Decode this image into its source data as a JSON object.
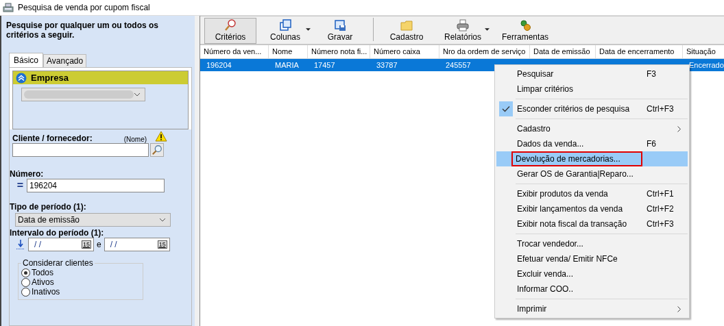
{
  "window": {
    "title": "Pesquisa de venda por cupom fiscal"
  },
  "criteria_panel": {
    "heading": "Pesquise por qualquer um ou todos os critérios a seguir.",
    "tabs": [
      {
        "label": "Básico",
        "selected": true
      },
      {
        "label": "Avançado",
        "selected": false
      }
    ],
    "empresa": {
      "label": "Empresa",
      "expanded": true
    },
    "cliente": {
      "label": "Cliente / fornecedor:",
      "hint": "(Nome)"
    },
    "numero": {
      "label": "Número:",
      "operator": "=",
      "value": "196204"
    },
    "tipo_periodo": {
      "label": "Tipo de período (1):",
      "value": "Data de emissão"
    },
    "intervalo": {
      "label": "Intervalo do período (1):",
      "from": "/ /",
      "to": "/ /",
      "joiner": "e",
      "from_calendar": "15",
      "to_calendar": "15"
    },
    "considerar_clientes": {
      "legend": "Considerar clientes",
      "options": [
        {
          "label": "Todos",
          "selected": true
        },
        {
          "label": "Ativos",
          "selected": false
        },
        {
          "label": "Inativos",
          "selected": false
        }
      ]
    }
  },
  "toolbar": [
    {
      "label": "Critérios",
      "selected": true,
      "dropdown": false,
      "group_start": false
    },
    {
      "label": "Colunas",
      "selected": false,
      "dropdown": true,
      "group_start": false
    },
    {
      "label": "Gravar",
      "selected": false,
      "dropdown": false,
      "group_start": false
    },
    {
      "label": "Cadastro",
      "selected": false,
      "dropdown": false,
      "group_start": true
    },
    {
      "label": "Relatórios",
      "selected": false,
      "dropdown": true,
      "group_start": false
    },
    {
      "label": "Ferramentas",
      "selected": false,
      "dropdown": false,
      "group_start": false
    }
  ],
  "table": {
    "columns": [
      "Número da ven...",
      "Nome",
      "Número nota fi...",
      "Número caixa",
      "Nro da ordem de serviço",
      "Data de emissão",
      "Data de encerramento",
      "Situação"
    ],
    "rows": [
      {
        "selected": true,
        "cells": [
          "196204",
          "MARIA",
          "17457",
          "33787",
          "245557",
          null,
          null,
          "Encerrado"
        ]
      }
    ]
  },
  "context_menu": [
    {
      "kind": "item",
      "label": "Pesquisar",
      "shortcut": "F3",
      "checked": false,
      "selected": false,
      "submenu": false,
      "annotated": false
    },
    {
      "kind": "item",
      "label": "Limpar critérios",
      "checked": false,
      "selected": false,
      "submenu": false,
      "annotated": false
    },
    {
      "kind": "separator"
    },
    {
      "kind": "item",
      "label": "Esconder critérios de pesquisa",
      "shortcut": "Ctrl+F3",
      "checked": true,
      "selected": false,
      "submenu": false,
      "annotated": false
    },
    {
      "kind": "separator"
    },
    {
      "kind": "item",
      "label": "Cadastro",
      "checked": false,
      "selected": false,
      "submenu": true,
      "annotated": false
    },
    {
      "kind": "item",
      "label": "Dados da venda...",
      "shortcut": "F6",
      "checked": false,
      "selected": false,
      "submenu": false,
      "annotated": false
    },
    {
      "kind": "item",
      "label": "Devolução de mercadorias...",
      "checked": false,
      "selected": true,
      "submenu": false,
      "annotated": true
    },
    {
      "kind": "item",
      "label": "Gerar OS de Garantia|Reparo...",
      "checked": false,
      "selected": false,
      "submenu": false,
      "annotated": false
    },
    {
      "kind": "separator"
    },
    {
      "kind": "item",
      "label": "Exibir produtos da venda",
      "shortcut": "Ctrl+F1",
      "checked": false,
      "selected": false,
      "submenu": false,
      "annotated": false
    },
    {
      "kind": "item",
      "label": "Exibir lançamentos da venda",
      "shortcut": "Ctrl+F2",
      "checked": false,
      "selected": false,
      "submenu": false,
      "annotated": false
    },
    {
      "kind": "item",
      "label": "Exibir nota fiscal da transação",
      "shortcut": "Ctrl+F3",
      "checked": false,
      "selected": false,
      "submenu": false,
      "annotated": false
    },
    {
      "kind": "separator"
    },
    {
      "kind": "item",
      "label": "Trocar vendedor...",
      "checked": false,
      "selected": false,
      "submenu": false,
      "annotated": false
    },
    {
      "kind": "item",
      "label": "Efetuar venda/ Emitir NFCe",
      "checked": false,
      "selected": false,
      "submenu": false,
      "annotated": false
    },
    {
      "kind": "item",
      "label": "Excluir venda...",
      "checked": false,
      "selected": false,
      "submenu": false,
      "annotated": false
    },
    {
      "kind": "item",
      "label": "Informar COO..",
      "checked": false,
      "selected": false,
      "submenu": false,
      "annotated": false
    },
    {
      "kind": "separator"
    },
    {
      "kind": "item",
      "label": "Imprimir",
      "checked": false,
      "selected": false,
      "submenu": true,
      "annotated": false
    }
  ]
}
